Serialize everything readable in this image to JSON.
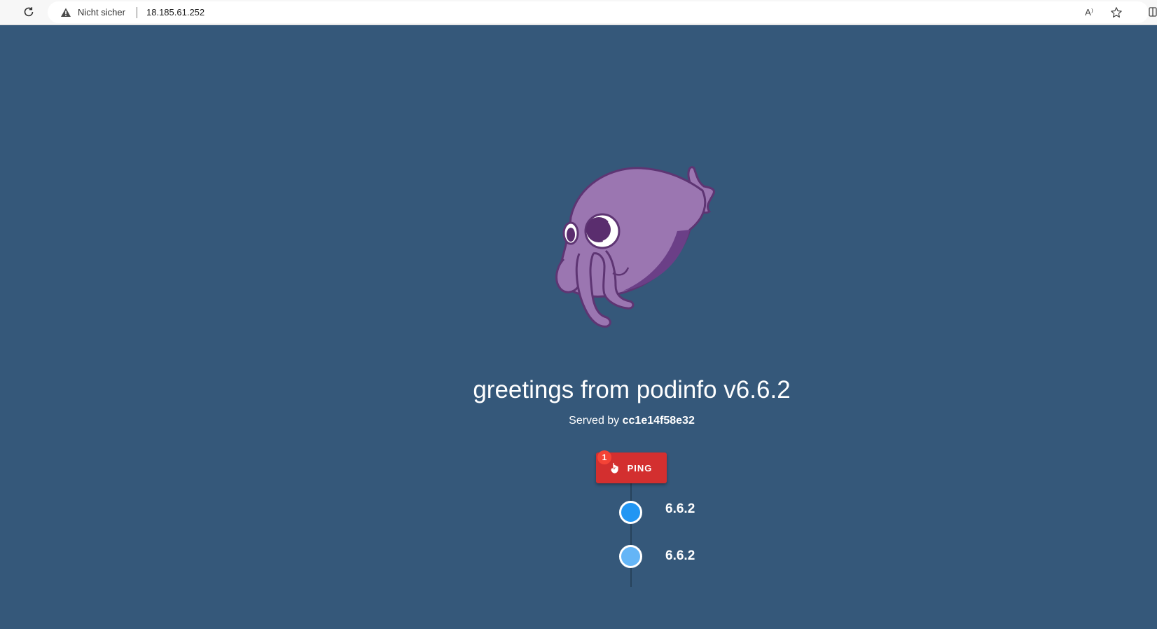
{
  "browser": {
    "security_label": "Nicht sicher",
    "url": "18.185.61.252",
    "read_aloud_label": "A⁾",
    "icons": [
      "reload-icon",
      "warning-icon",
      "read-aloud-icon",
      "favorite-star-icon",
      "split-screen-icon"
    ]
  },
  "page": {
    "background": "#35587a",
    "headline": "greetings from podinfo v6.6.2",
    "served_prefix": "Served by ",
    "served_host": "cc1e14f58e32",
    "mascot": "cuttlefish-mascot"
  },
  "ping": {
    "label": "PING",
    "badge": "1",
    "color": "#d32f2f",
    "badge_color": "#f44336"
  },
  "timeline": {
    "items": [
      {
        "label": "6.6.2",
        "color": "#2196f3"
      },
      {
        "label": "6.6.2",
        "color": "#64b5f6"
      }
    ]
  }
}
